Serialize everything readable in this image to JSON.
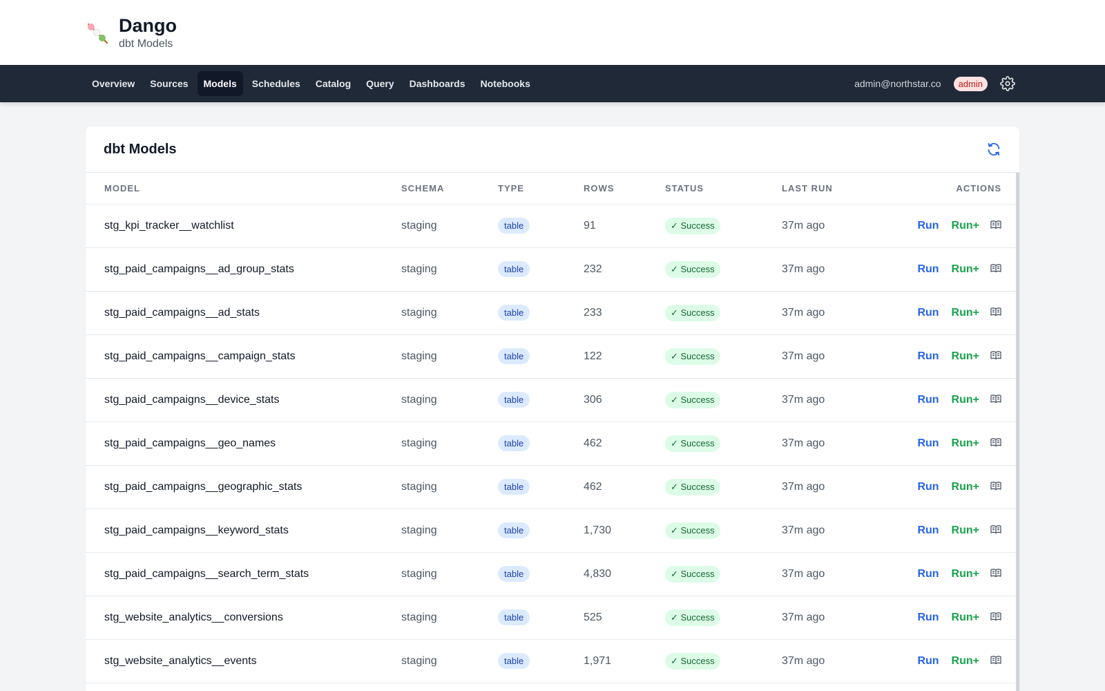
{
  "app": {
    "title": "Dango",
    "subtitle": "dbt Models",
    "logo_icon": "dango-skewer-icon"
  },
  "nav": {
    "items": [
      {
        "label": "Overview",
        "active": false
      },
      {
        "label": "Sources",
        "active": false
      },
      {
        "label": "Models",
        "active": true
      },
      {
        "label": "Schedules",
        "active": false
      },
      {
        "label": "Catalog",
        "active": false
      },
      {
        "label": "Query",
        "active": false
      },
      {
        "label": "Dashboards",
        "active": false
      },
      {
        "label": "Notebooks",
        "active": false
      }
    ],
    "user_email": "admin@northstar.co",
    "role": "admin",
    "settings_icon": "gear-icon"
  },
  "card": {
    "title": "dbt Models",
    "refresh_icon": "refresh-icon"
  },
  "table": {
    "columns": {
      "model": "MODEL",
      "schema": "SCHEMA",
      "type": "TYPE",
      "rows": "ROWS",
      "status": "STATUS",
      "last_run": "LAST RUN",
      "actions": "ACTIONS"
    },
    "action_labels": {
      "run": "Run",
      "run_plus": "Run+",
      "docs_icon": "book-icon"
    },
    "rows": [
      {
        "model": "stg_kpi_tracker__watchlist",
        "schema": "staging",
        "type": "table",
        "rows": "91",
        "status": "✓ Success",
        "last_run": "37m ago"
      },
      {
        "model": "stg_paid_campaigns__ad_group_stats",
        "schema": "staging",
        "type": "table",
        "rows": "232",
        "status": "✓ Success",
        "last_run": "37m ago"
      },
      {
        "model": "stg_paid_campaigns__ad_stats",
        "schema": "staging",
        "type": "table",
        "rows": "233",
        "status": "✓ Success",
        "last_run": "37m ago"
      },
      {
        "model": "stg_paid_campaigns__campaign_stats",
        "schema": "staging",
        "type": "table",
        "rows": "122",
        "status": "✓ Success",
        "last_run": "37m ago"
      },
      {
        "model": "stg_paid_campaigns__device_stats",
        "schema": "staging",
        "type": "table",
        "rows": "306",
        "status": "✓ Success",
        "last_run": "37m ago"
      },
      {
        "model": "stg_paid_campaigns__geo_names",
        "schema": "staging",
        "type": "table",
        "rows": "462",
        "status": "✓ Success",
        "last_run": "37m ago"
      },
      {
        "model": "stg_paid_campaigns__geographic_stats",
        "schema": "staging",
        "type": "table",
        "rows": "462",
        "status": "✓ Success",
        "last_run": "37m ago"
      },
      {
        "model": "stg_paid_campaigns__keyword_stats",
        "schema": "staging",
        "type": "table",
        "rows": "1,730",
        "status": "✓ Success",
        "last_run": "37m ago"
      },
      {
        "model": "stg_paid_campaigns__search_term_stats",
        "schema": "staging",
        "type": "table",
        "rows": "4,830",
        "status": "✓ Success",
        "last_run": "37m ago"
      },
      {
        "model": "stg_website_analytics__conversions",
        "schema": "staging",
        "type": "table",
        "rows": "525",
        "status": "✓ Success",
        "last_run": "37m ago"
      },
      {
        "model": "stg_website_analytics__events",
        "schema": "staging",
        "type": "table",
        "rows": "1,971",
        "status": "✓ Success",
        "last_run": "37m ago"
      }
    ]
  },
  "colors": {
    "navbar_bg": "#1f2937",
    "run_link": "#2563eb",
    "run_plus_link": "#16a34a",
    "type_badge_bg": "#dbeafe",
    "status_badge_bg": "#dcfce7",
    "role_badge_bg": "#fee2e2"
  }
}
